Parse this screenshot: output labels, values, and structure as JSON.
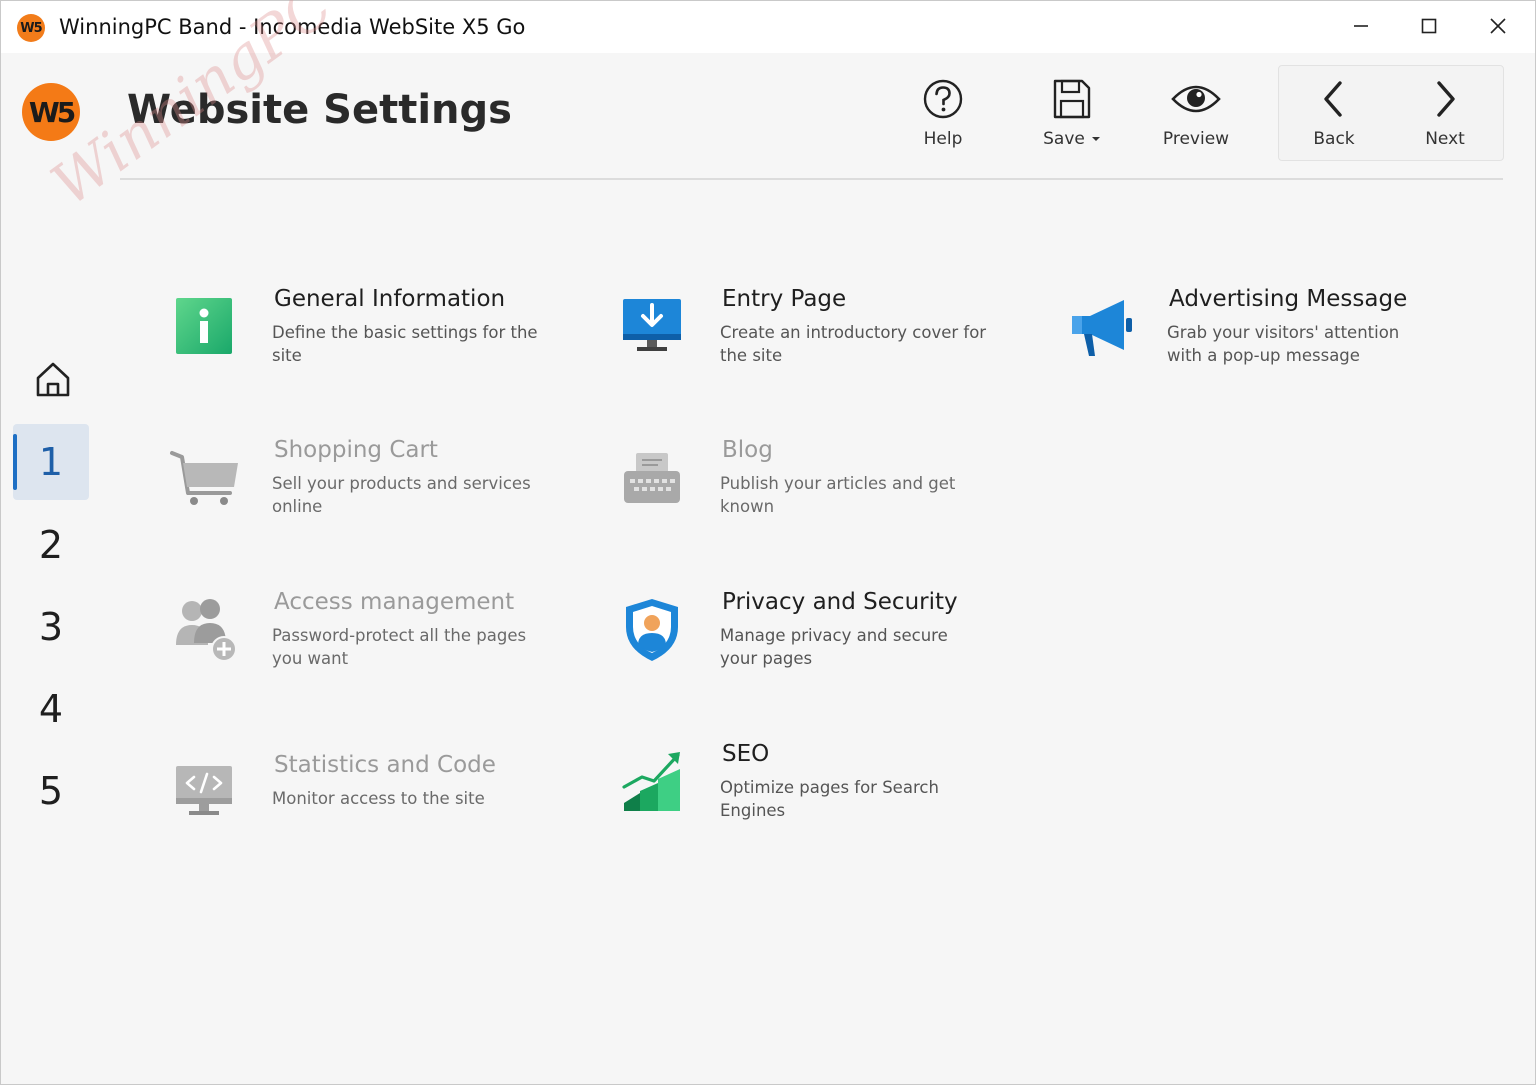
{
  "window": {
    "title": "WinningPC Band - Incomedia WebSite X5 Go",
    "logo_text": "W5"
  },
  "header": {
    "logo_text": "W5",
    "title": "Website Settings",
    "watermark": "WinningPC"
  },
  "toolbar": {
    "help_label": "Help",
    "save_label": "Save",
    "preview_label": "Preview",
    "back_label": "Back",
    "next_label": "Next"
  },
  "sidebar": {
    "steps": [
      "1",
      "2",
      "3",
      "4",
      "5"
    ],
    "active_step": "1"
  },
  "cards": [
    {
      "title": "General Information",
      "description": "Define the basic settings for the site",
      "icon": "info-icon",
      "enabled": true
    },
    {
      "title": "Entry Page",
      "description": "Create an introductory cover for the site",
      "icon": "monitor-download-icon",
      "enabled": true
    },
    {
      "title": "Advertising Message",
      "description": "Grab your visitors' attention with a pop-up message",
      "icon": "megaphone-icon",
      "enabled": true
    },
    {
      "title": "Shopping Cart",
      "description": "Sell your products and services online",
      "icon": "cart-icon",
      "enabled": false
    },
    {
      "title": "Blog",
      "description": "Publish your articles and get known",
      "icon": "typewriter-icon",
      "enabled": false
    },
    {
      "title": "Access management",
      "description": "Password-protect all the pages you want",
      "icon": "users-add-icon",
      "enabled": false
    },
    {
      "title": "Privacy and Security",
      "description": "Manage privacy and secure your pages",
      "icon": "shield-user-icon",
      "enabled": true
    },
    {
      "title": "Statistics and Code",
      "description": "Monitor access to the site",
      "icon": "code-monitor-icon",
      "enabled": false
    },
    {
      "title": "SEO",
      "description": "Optimize pages for Search Engines",
      "icon": "growth-chart-icon",
      "enabled": true
    }
  ],
  "colors": {
    "accent": "#1e6fc4",
    "logo": "#f47a16"
  }
}
